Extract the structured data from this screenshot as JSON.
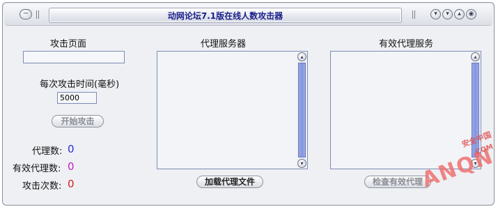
{
  "window": {
    "title": "动网论坛7.1版在线人数攻击器",
    "menu_glyph": "−",
    "controls": [
      "▾",
      "▾",
      "▴",
      "◉"
    ]
  },
  "left": {
    "attack_page_label": "攻击页面",
    "attack_page_value": "",
    "interval_label": "每次攻击时间(毫秒)",
    "interval_value": "5000",
    "start_button": "开始攻击",
    "proxy_count_label": "代理数:",
    "proxy_count_value": "0",
    "valid_count_label": "有效代理数:",
    "valid_count_value": "0",
    "attack_count_label": "攻击次数:",
    "attack_count_value": "0"
  },
  "middle": {
    "header": "代理服务器",
    "load_button": "加载代理文件"
  },
  "right": {
    "header": "有效代理服务",
    "check_button": "检查有效代理"
  },
  "colors": {
    "proxy_count": "#2d2dd0",
    "valid_count": "#c020c0",
    "attack_count": "#d02020",
    "title_text": "#1a1f8a"
  },
  "watermark": {
    "main": "ANQN",
    "sub": "安全中国",
    "com": ".COM"
  }
}
